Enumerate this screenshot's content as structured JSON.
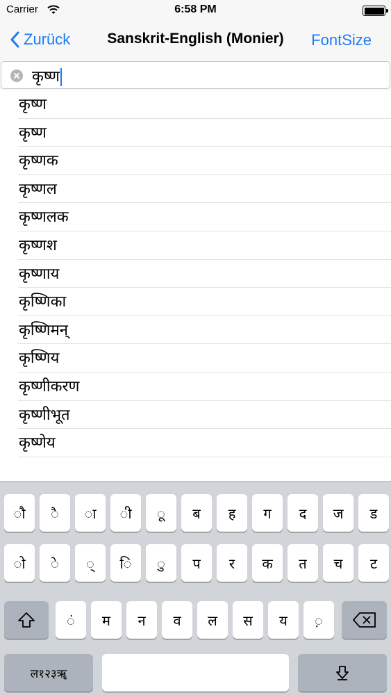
{
  "status_bar": {
    "carrier": "Carrier",
    "time": "6:58 PM",
    "battery_level": 1.0
  },
  "nav": {
    "back_label": "Zurück",
    "title": "Sanskrit-English (Monier)",
    "right_label": "FontSize"
  },
  "search": {
    "value": "कृष्ण"
  },
  "results": [
    "कृष्ण",
    "कृष्ण",
    "कृष्णक",
    "कृष्णल",
    "कृष्णलक",
    "कृष्णश",
    "कृष्णाय",
    "कृष्णिका",
    "कृष्णिमन्",
    "कृष्णिय",
    "कृष्णीकरण",
    "कृष्णीभूत",
    "कृष्णेय"
  ],
  "keyboard": {
    "row1": [
      "ौ",
      "ै",
      "ा",
      "ी",
      "ू",
      "ब",
      "ह",
      "ग",
      "द",
      "ज",
      "ड"
    ],
    "row2": [
      "ो",
      "े",
      "्",
      "ि",
      "ु",
      "प",
      "र",
      "क",
      "त",
      "च",
      "ट"
    ],
    "row3": [
      "ं",
      "म",
      "न",
      "व",
      "ल",
      "स",
      "य",
      "़"
    ],
    "mode_key": "ल१२३ॠ",
    "shift_icon": "shift-icon",
    "delete_icon": "delete-icon",
    "globe_icon": "keyboard-switch-icon"
  },
  "colors": {
    "accent": "#1a7cf5",
    "keyboard_bg": "#d1d4d9",
    "dark_key": "#adb3bc"
  }
}
